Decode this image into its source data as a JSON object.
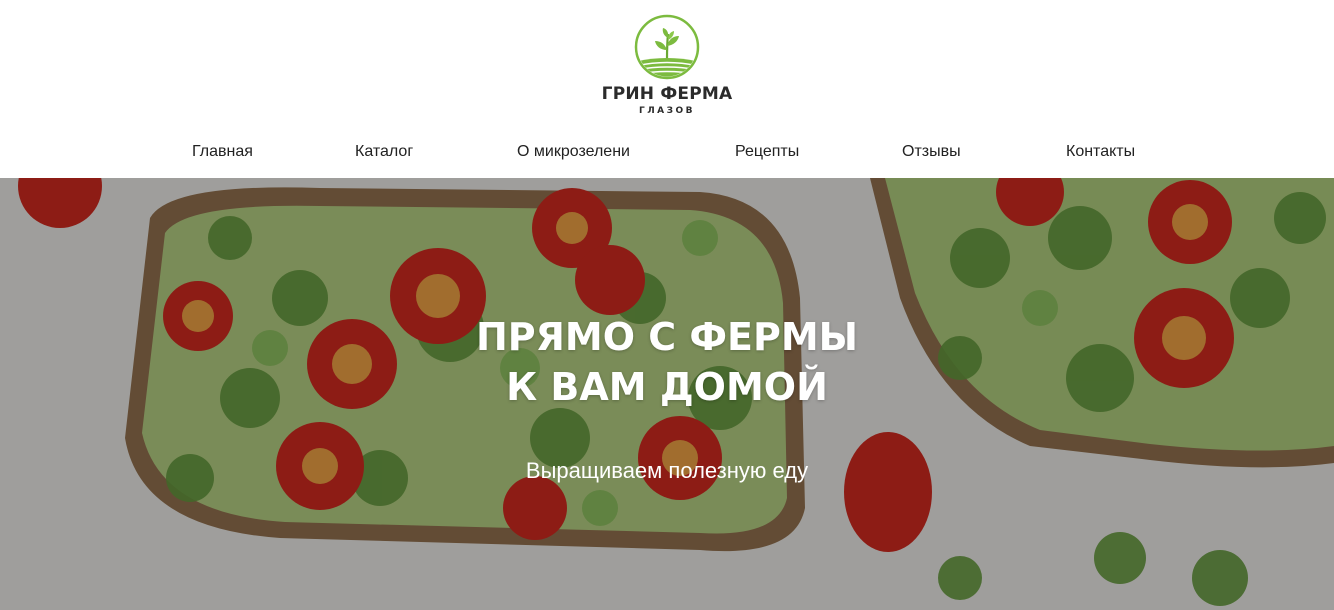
{
  "brand": {
    "name": "ГРИН ФЕРМА",
    "city": "ГЛАЗОВ",
    "logo_icon": "sprout-field-logo-icon",
    "accent_color": "#7cbb3f"
  },
  "nav": {
    "items": [
      {
        "label": "Главная"
      },
      {
        "label": "Каталог"
      },
      {
        "label": "О микрозелени"
      },
      {
        "label": "Рецепты"
      },
      {
        "label": "Отзывы"
      },
      {
        "label": "Контакты"
      }
    ]
  },
  "hero": {
    "title_line1": "ПРЯМО С ФЕРМЫ",
    "title_line2": "К ВАМ ДОМОЙ",
    "subtitle": "Выращиваем полезную еду",
    "background_image": "avocado-toast-with-microgreens-and-cherry-tomatoes"
  }
}
